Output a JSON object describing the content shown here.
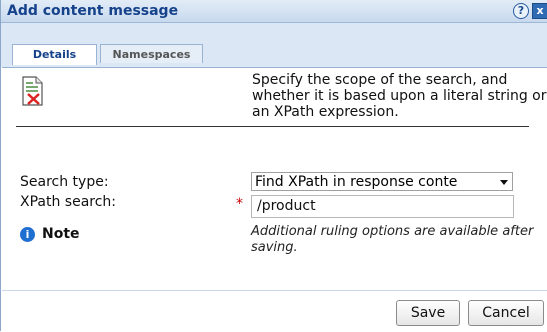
{
  "dialog": {
    "title": "Add content message",
    "help_glyph": "?",
    "close_glyph": "x"
  },
  "tabs": [
    {
      "label": "Details",
      "active": true
    },
    {
      "label": "Namespaces",
      "active": false
    }
  ],
  "icon": "document-error-icon",
  "description": "Specify the scope of the search, and whether it is based upon a literal string or an XPath expression.",
  "form": {
    "search_type_label": "Search type:",
    "search_type_value": "Find XPath in response conte",
    "xpath_label": "XPath search:",
    "xpath_value": "/product",
    "required_mark": "*"
  },
  "note": {
    "icon_glyph": "i",
    "label": "Note",
    "text": "Additional ruling options are available after saving."
  },
  "buttons": {
    "save": "Save",
    "cancel": "Cancel"
  },
  "colors": {
    "title_text": "#15428b",
    "tab_strip": "#dbe7f5",
    "required": "#cc0000",
    "info": "#1f6fd1"
  }
}
